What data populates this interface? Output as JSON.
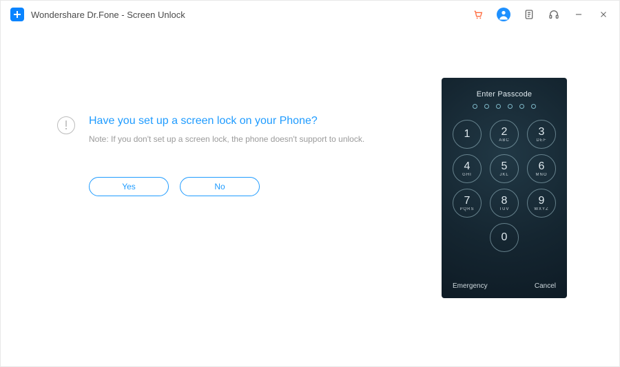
{
  "window": {
    "title": "Wondershare Dr.Fone - Screen Unlock"
  },
  "titlebar": {
    "icons": {
      "cart": "cart-icon",
      "user": "user-icon",
      "notes": "notes-icon",
      "support": "headset-icon",
      "minimize": "minimize-icon",
      "close": "close-icon"
    }
  },
  "prompt": {
    "question": "Have you set up a screen lock on your Phone?",
    "note": "Note: If you don't set up a screen lock, the phone doesn't support to unlock.",
    "yes_label": "Yes",
    "no_label": "No"
  },
  "phone": {
    "enter_label": "Enter Passcode",
    "passcode_length": 6,
    "keys": [
      {
        "num": "1",
        "letters": ""
      },
      {
        "num": "2",
        "letters": "ABC"
      },
      {
        "num": "3",
        "letters": "DEF"
      },
      {
        "num": "4",
        "letters": "GHI"
      },
      {
        "num": "5",
        "letters": "JKL"
      },
      {
        "num": "6",
        "letters": "MNO"
      },
      {
        "num": "7",
        "letters": "PQRS"
      },
      {
        "num": "8",
        "letters": "TUV"
      },
      {
        "num": "9",
        "letters": "WXYZ"
      },
      {
        "num": "0",
        "letters": ""
      }
    ],
    "emergency_label": "Emergency",
    "cancel_label": "Cancel"
  }
}
